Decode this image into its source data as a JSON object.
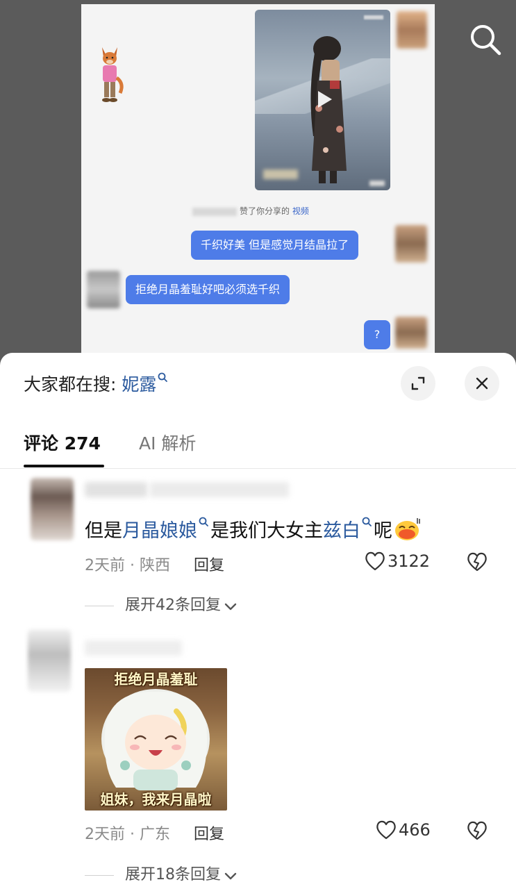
{
  "chat_screenshot": {
    "video_card": {
      "play_icon": "play-icon"
    },
    "system_line": {
      "suffix": "赞了你分享的",
      "link": "视频"
    },
    "messages": [
      {
        "side": "right",
        "text": "千织好美 但是感觉月结晶拉了"
      },
      {
        "side": "left",
        "text": "拒绝月晶羞耻好吧必须选千织"
      },
      {
        "side": "right",
        "text": "?"
      }
    ],
    "colors": {
      "bubble": "#4e7ce8",
      "link": "#3a66c9"
    }
  },
  "top_bar": {
    "search_icon": "search-icon"
  },
  "sheet": {
    "hot_search": {
      "prefix": "大家都在搜:",
      "term": "妮露"
    },
    "expand_icon": "expand-icon",
    "close_icon": "close-icon",
    "tabs": [
      {
        "label": "评论 274",
        "active": true
      },
      {
        "label": "AI 解析",
        "active": false
      }
    ],
    "comments": [
      {
        "segments": {
          "a": "但是",
          "kw1": "月晶娘娘",
          "b": "是我们大女主",
          "kw2": "兹白",
          "c": "呢"
        },
        "time": "2天前",
        "location": "陕西",
        "reply": "回复",
        "likes": "3122",
        "expand": "展开42条回复"
      },
      {
        "sticker": {
          "top_text": "拒绝月晶羞耻",
          "bottom_text": "姐妹，我来月晶啦"
        },
        "time": "2天前",
        "location": "广东",
        "reply": "回复",
        "likes": "466",
        "expand": "展开18条回复"
      }
    ],
    "colors": {
      "keyword": "#2b5a9e",
      "meta": "#8a8a8a"
    }
  }
}
